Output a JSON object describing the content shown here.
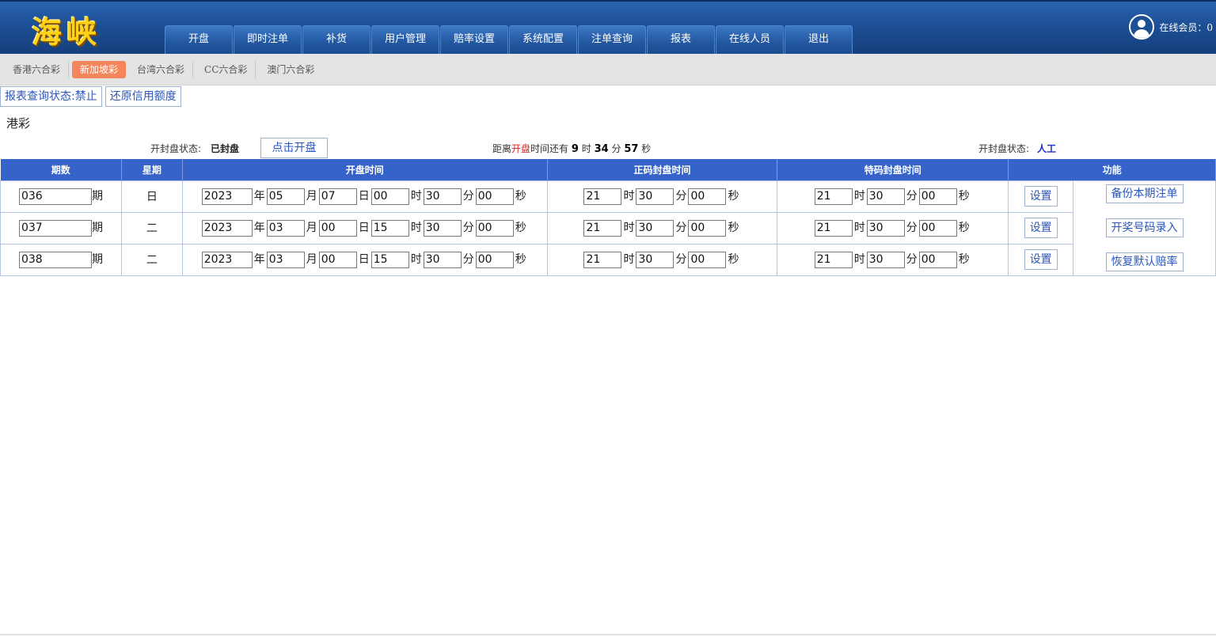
{
  "header": {
    "logo": "海峡",
    "nav": [
      "开盘",
      "即时注单",
      "补货",
      "用户管理",
      "赔率设置",
      "系统配置",
      "注单查询",
      "报表",
      "在线人员",
      "退出"
    ],
    "online_label": "在线会员：0"
  },
  "subtabs": [
    "香港六合彩",
    "新加坡彩",
    "台湾六合彩",
    "CC六合彩",
    "澳门六合彩"
  ],
  "actions": {
    "report_status": "报表查询状态:禁止",
    "restore_credit": "还原信用额度"
  },
  "section_title": "港彩",
  "status": {
    "label": "开封盘状态:",
    "value": "已封盘",
    "open_button": "点击开盘",
    "countdown_prefix": "距离",
    "countdown_red": "开盘",
    "countdown_mid": "时间还有",
    "hours": "9",
    "hour_unit": "时",
    "minutes": "34",
    "minute_unit": "分",
    "seconds": "57",
    "second_unit": "秒",
    "mode_label": "开封盘状态:",
    "mode_value": "人工"
  },
  "table": {
    "headers": [
      "期数",
      "星期",
      "开盘时间",
      "正码封盘时间",
      "特码封盘时间",
      "功能"
    ],
    "units": {
      "period": "期",
      "year": "年",
      "month": "月",
      "day": "日",
      "hour": "时",
      "minute": "分",
      "second": "秒"
    },
    "set_label": "设置",
    "rows": [
      {
        "period": "036",
        "weekday": "日",
        "year": "2023",
        "month": "05",
        "day": "07",
        "hour": "00",
        "minute": "30",
        "second": "00",
        "z_hour": "21",
        "z_minute": "30",
        "z_second": "00",
        "t_hour": "21",
        "t_minute": "30",
        "t_second": "00"
      },
      {
        "period": "037",
        "weekday": "二",
        "year": "2023",
        "month": "03",
        "day": "00",
        "hour": "15",
        "minute": "30",
        "second": "00",
        "z_hour": "21",
        "z_minute": "30",
        "z_second": "00",
        "t_hour": "21",
        "t_minute": "30",
        "t_second": "00"
      },
      {
        "period": "038",
        "weekday": "二",
        "year": "2023",
        "month": "03",
        "day": "00",
        "hour": "15",
        "minute": "30",
        "second": "00",
        "z_hour": "21",
        "z_minute": "30",
        "z_second": "00",
        "t_hour": "21",
        "t_minute": "30",
        "t_second": "00"
      }
    ],
    "functions": [
      "备份本期注单",
      "开奖号码录入",
      "恢复默认赔率"
    ]
  },
  "colors": {
    "header_blue": "#1d4f95",
    "table_header": "#3563c9",
    "active_tab": "#f5865c",
    "link_blue": "#2c56b8",
    "countdown_red": "#d82020",
    "mode_blue": "#1a2fd0"
  }
}
